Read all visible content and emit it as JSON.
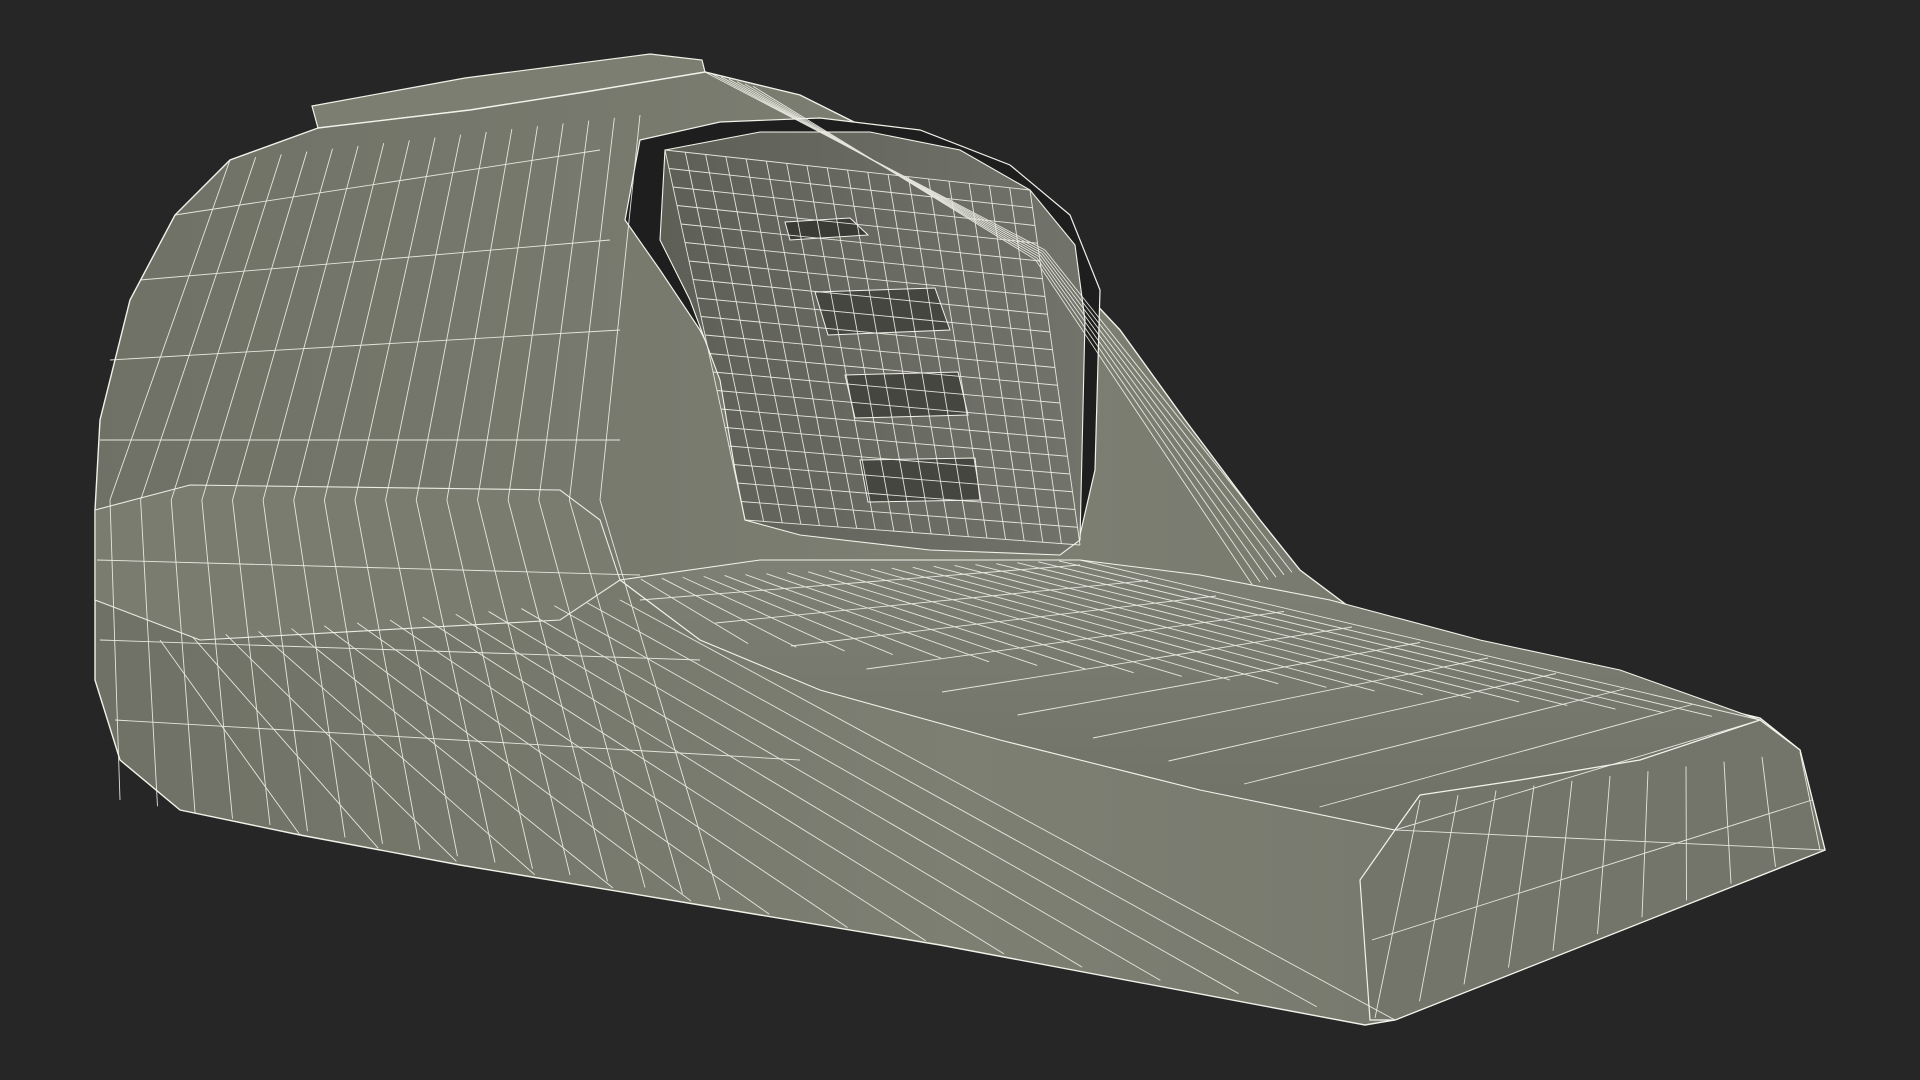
{
  "scene": {
    "subject": "wireframe-3d-model",
    "colors": {
      "background": "#262626",
      "surface": "#7a7b70",
      "surface_light": "#878a7e",
      "surface_dark": "#6a6b61",
      "shadow": "#4a4b44",
      "wire": "#f2f2ea"
    }
  }
}
